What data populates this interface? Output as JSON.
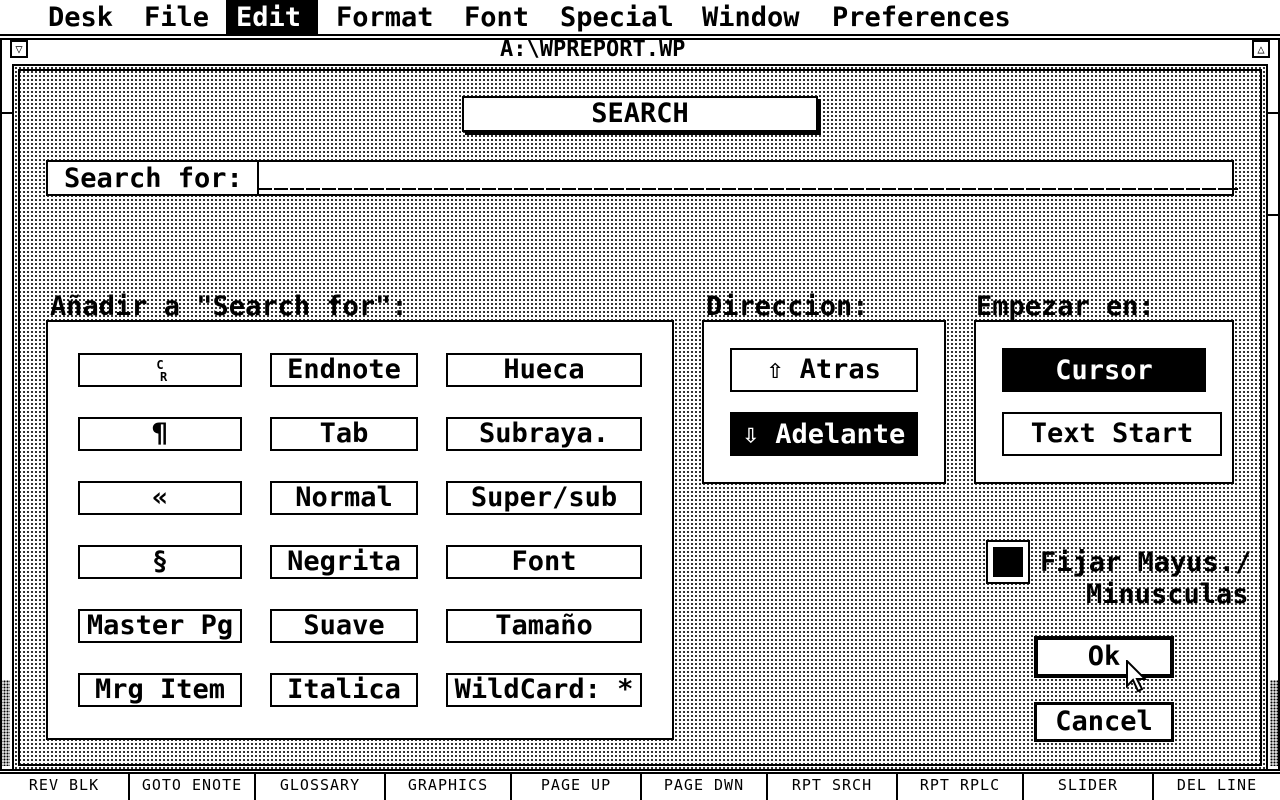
{
  "menu": {
    "items": [
      {
        "label": "Desk"
      },
      {
        "label": "File"
      },
      {
        "label": "Edit"
      },
      {
        "label": "Format"
      },
      {
        "label": "Font"
      },
      {
        "label": "Special"
      },
      {
        "label": "Window"
      },
      {
        "label": "Preferences"
      }
    ],
    "active": "Edit"
  },
  "window": {
    "title": "A:\\WPREPORT.WP"
  },
  "dialog": {
    "title": "SEARCH",
    "search_label": "Search for:",
    "search_value": "",
    "add_label": "Añadir a \"Search for\":",
    "add_buttons": [
      [
        "CR",
        "Endnote",
        "Hueca"
      ],
      [
        "¶",
        "Tab",
        "Subraya."
      ],
      [
        "«",
        "Normal",
        "Super/sub"
      ],
      [
        "§",
        "Negrita",
        "Font"
      ],
      [
        "Master Pg",
        "Suave",
        "Tamaño"
      ],
      [
        "Mrg Item",
        "Italica",
        "WildCard: *"
      ]
    ],
    "direction_label": "Direccion:",
    "direction_options": [
      "⇧ Atras",
      "⇩ Adelante"
    ],
    "direction_selected": "⇩ Adelante",
    "start_label": "Empezar en:",
    "start_options": [
      "Cursor",
      "Text Start"
    ],
    "start_selected": "Cursor",
    "case_checkbox": {
      "line1": "Fijar Mayus./",
      "line2": "Minusculas",
      "checked": true
    },
    "ok_label": "Ok",
    "cancel_label": "Cancel"
  },
  "function_keys": [
    "REV BLK",
    "GOTO ENOTE",
    "GLOSSARY",
    "GRAPHICS",
    "PAGE UP",
    "PAGE DWN",
    "RPT SRCH",
    "RPT RPLC",
    "SLIDER",
    "DEL LINE"
  ]
}
